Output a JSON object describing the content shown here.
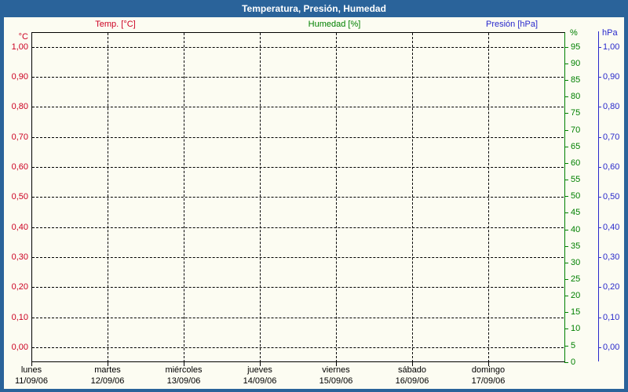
{
  "window": {
    "title": "Temperatura, Presión, Humedad"
  },
  "colors": {
    "frame_blue": "#2a639a",
    "background": "#fcfcf2",
    "temp_red": "#cc0022",
    "humidity_green": "#008000",
    "pressure_blue": "#2828cc",
    "grid_black": "#000000"
  },
  "legend": {
    "temp": "Temp. [°C]",
    "humidity": "Humedad [%]",
    "pressure": "Presión [hPa]"
  },
  "chart_data": {
    "type": "line",
    "title": "Temperatura, Presión, Humedad",
    "grid": "dashed",
    "legend_position": "top",
    "series": [
      {
        "name": "Temp. [°C]",
        "color": "#cc0022",
        "axis": "temp",
        "values": []
      },
      {
        "name": "Humedad [%]",
        "color": "#008000",
        "axis": "humidity",
        "values": []
      },
      {
        "name": "Presión [hPa]",
        "color": "#2828cc",
        "axis": "pressure",
        "values": []
      }
    ],
    "y_axis_left": {
      "unit": "°C",
      "color": "#cc0022",
      "range": [
        0,
        1
      ],
      "ticks": [
        "1,00",
        "0,90",
        "0,80",
        "0,70",
        "0,60",
        "0,50",
        "0,40",
        "0,30",
        "0,20",
        "0,10",
        "0,00"
      ]
    },
    "y_axis_right_inner": {
      "unit": "%",
      "color": "#008000",
      "range": [
        0,
        95
      ],
      "ticks": [
        "95",
        "90",
        "85",
        "80",
        "75",
        "70",
        "65",
        "60",
        "55",
        "50",
        "45",
        "40",
        "35",
        "30",
        "25",
        "20",
        "15",
        "10",
        "5",
        "0"
      ]
    },
    "y_axis_right_outer": {
      "unit": "hPa",
      "color": "#2828cc",
      "range": [
        0,
        1
      ],
      "ticks": [
        "1,00",
        "0,90",
        "0,80",
        "0,70",
        "0,60",
        "0,50",
        "0,40",
        "0,30",
        "0,20",
        "0,10",
        "0,00"
      ]
    },
    "x_axis": {
      "days": [
        {
          "name": "lunes",
          "date": "11/09/06"
        },
        {
          "name": "martes",
          "date": "12/09/06"
        },
        {
          "name": "miércoles",
          "date": "13/09/06"
        },
        {
          "name": "jueves",
          "date": "14/09/06"
        },
        {
          "name": "viernes",
          "date": "15/09/06"
        },
        {
          "name": "sábado",
          "date": "16/09/06"
        },
        {
          "name": "domingo",
          "date": "17/09/06"
        }
      ]
    }
  }
}
